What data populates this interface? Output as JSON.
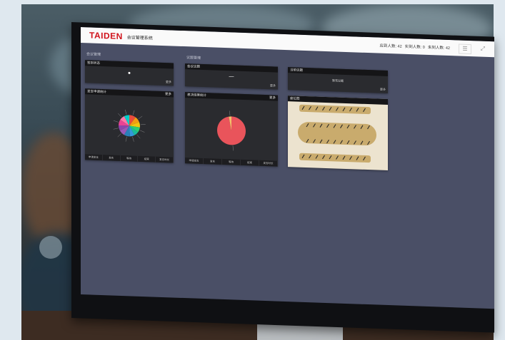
{
  "app": {
    "brand": "TAIDEN",
    "title": "会议管理系统"
  },
  "header": {
    "stats": [
      "应到人数: 42",
      "实到人数: 0",
      "未到人数: 42"
    ],
    "icons": [
      "list-icon",
      "expand-icon"
    ]
  },
  "sections": [
    "会议管理",
    "议题管理"
  ],
  "panels": [
    {
      "title": "签到状态",
      "value": "●",
      "footer": "更多"
    },
    {
      "title": "会议议题",
      "value": "—",
      "footer": "更多"
    },
    {
      "title": "当前议题",
      "value": "暂无议题",
      "footer": "更多"
    },
    {
      "title": "发言申请统计",
      "footer": "更多",
      "tabs": [
        "申请发言",
        "发言",
        "等待",
        "结束",
        "发言时长"
      ]
    },
    {
      "title": "表决结果统计",
      "footer": "更多",
      "tabs": [
        "申请发言",
        "发言",
        "等待",
        "结束",
        "发言时长"
      ]
    },
    {
      "title": "座位图",
      "footer": ""
    }
  ],
  "chart_data": [
    {
      "type": "pie",
      "values": [
        10,
        9,
        8,
        8,
        7,
        7,
        9,
        9,
        8,
        9,
        8,
        8
      ],
      "colors": [
        "#e74c3c",
        "#f39c12",
        "#f1c40f",
        "#2ecc71",
        "#1abc9c",
        "#3498db",
        "#2980b9",
        "#9b59b6",
        "#8e44ad",
        "#e84393",
        "#fd79a8",
        "#00cec9"
      ],
      "labels": [],
      "title": ""
    },
    {
      "type": "pie",
      "values": [
        97,
        3
      ],
      "colors": [
        "#e9545b",
        "#f4c06a"
      ],
      "labels": [],
      "title": ""
    }
  ]
}
